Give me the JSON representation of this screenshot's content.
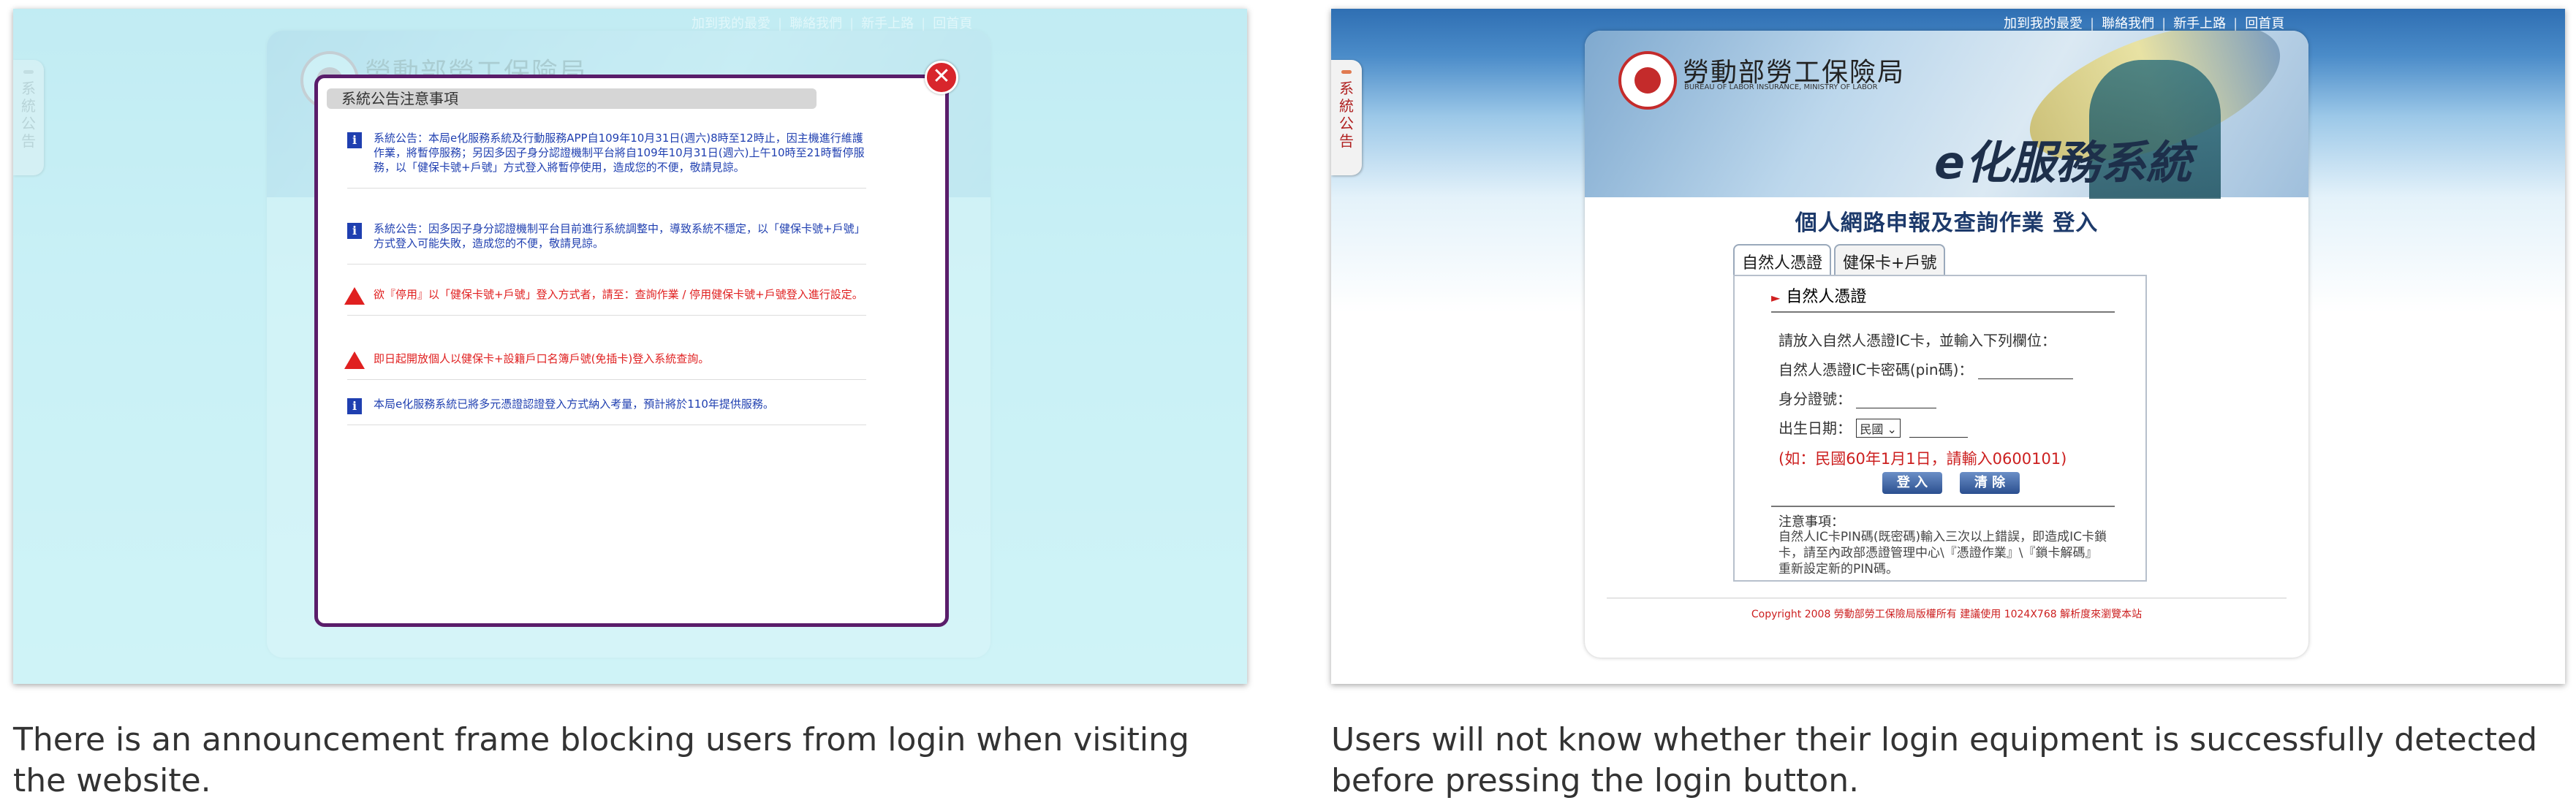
{
  "top_links": [
    "加到我的最愛",
    "聯絡我們",
    "新手上路",
    "回首頁"
  ],
  "side_tab_label": "系統公告",
  "site": {
    "org_name": "勞動部勞工保險局",
    "org_sub": "BUREAU OF LABOR INSURANCE, MINISTRY OF LABOR",
    "brand": "e化服務系統"
  },
  "left": {
    "modal_title": "系統公告注意事項",
    "close_symbol": "✕",
    "notices": [
      {
        "type": "info",
        "text": "系統公告：本局e化服務系統及行動服務APP自109年10月31日(週六)8時至12時止，因主機進行維護作業，將暫停服務；另因多因子身分認證機制平台將自109年10月31日(週六)上午10時至21時暫停服務，以「健保卡號+戶號」方式登入將暫停使用，造成您的不便，敬請見諒。"
      },
      {
        "type": "info",
        "text": "系統公告：因多因子身分認證機制平台目前進行系統調整中，導致系統不穩定，以「健保卡號+戶號」方式登入可能失敗，造成您的不便，敬請見諒。"
      },
      {
        "type": "warn",
        "text": "欲『停用』以「健保卡號+戶號」登入方式者，請至：查詢作業 / 停用健保卡號+戶號登入進行設定。"
      },
      {
        "type": "warn",
        "text": "即日起開放個人以健保卡+設籍戶口名簿戶號(免插卡)登入系統查詢。"
      },
      {
        "type": "info",
        "text": "本局e化服務系統已將多元憑證認證登入方式納入考量，預計將於110年提供服務。"
      }
    ],
    "caption": "There is an announcement frame blocking users from login when visiting the website."
  },
  "right": {
    "login_title": "個人網路申報及查詢作業 登入",
    "tabs": [
      "自然人憑證",
      "健保卡+戶號"
    ],
    "section_head": "自然人憑證",
    "instruction": "請放入自然人憑證IC卡，並輸入下列欄位：",
    "pin_label": "自然人憑證IC卡密碼(pin碼)：",
    "id_label": "身分證號：",
    "birth_label": "出生日期：",
    "birth_select": "民國",
    "hint": "(如：民國60年1月1日，請輸入0600101)",
    "login_button": "登 入",
    "clear_button": "清 除",
    "note_title": "注意事項：",
    "note_body": "自然人IC卡PIN碼(既密碼)輸入三次以上錯誤，即造成IC卡鎖卡，請至內政部憑證管理中心\\『憑證作業』\\『鎖卡解碼』重新設定新的PIN碼。",
    "copyright": "Copyright 2008 勞動部勞工保險局版權所有 建議使用 1024X768 解析度來瀏覽本站",
    "caption": "Users will not know whether their login equipment is successfully detected before pressing the login button."
  },
  "colors": {
    "modal_border": "#5a1d6a",
    "info_blue": "#1f3fb0",
    "warn_red": "#e02020",
    "close_red": "#d8262c"
  }
}
